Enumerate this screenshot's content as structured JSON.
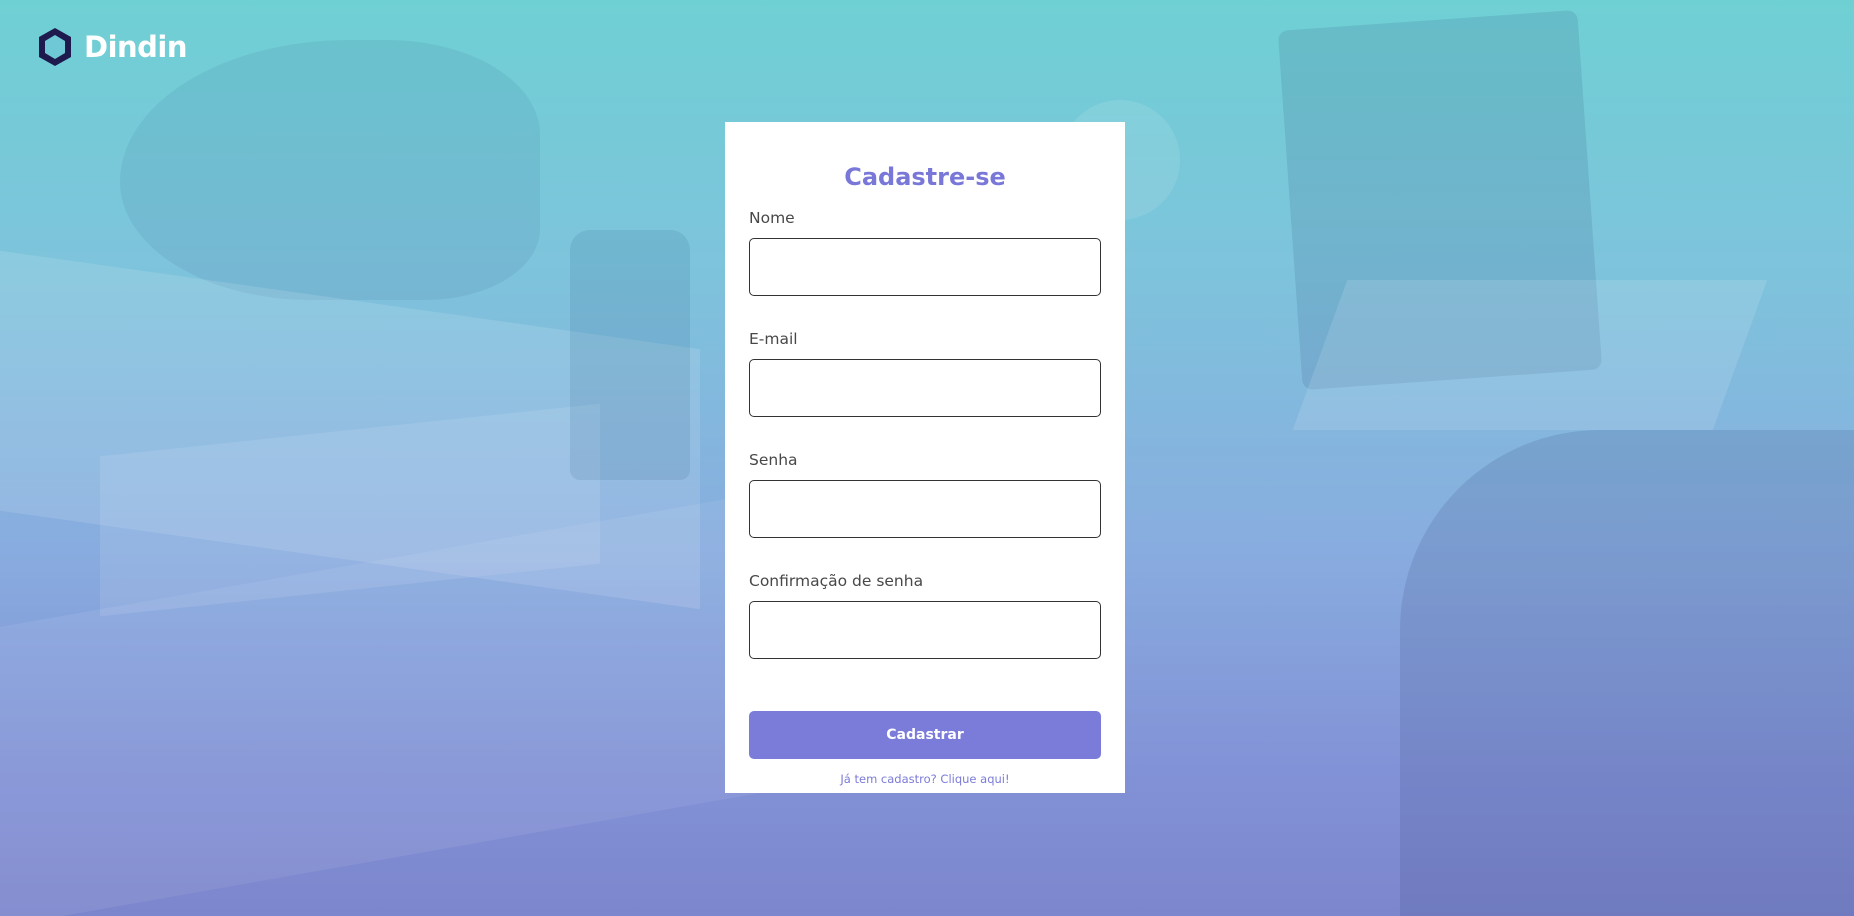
{
  "brand": {
    "name": "Dindin",
    "logo_icon": "hexagon-logo-icon",
    "logo_color": "#1f1a4d",
    "logo_inner_color": "#6fc8d6"
  },
  "form": {
    "title": "Cadastre-se",
    "fields": [
      {
        "label": "Nome",
        "value": "",
        "type": "text"
      },
      {
        "label": "E-mail",
        "value": "",
        "type": "email"
      },
      {
        "label": "Senha",
        "value": "",
        "type": "password"
      },
      {
        "label": "Confirmação de senha",
        "value": "",
        "type": "password"
      }
    ],
    "submit_label": "Cadastrar",
    "login_link": "Já tem cadastro? Clique aqui!"
  },
  "colors": {
    "accent": "#7b7bd9",
    "background_top": "#6fd0d4",
    "background_bottom": "#7c86cc",
    "card": "#ffffff"
  }
}
